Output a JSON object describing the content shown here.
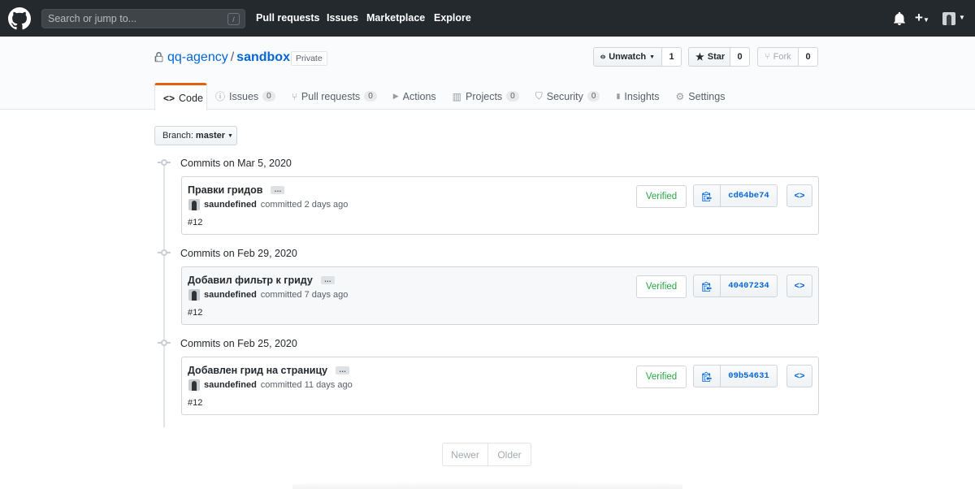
{
  "topnav": {
    "search_placeholder": "Search or jump to...",
    "search_hint": "/",
    "links": [
      "Pull requests",
      "Issues",
      "Marketplace",
      "Explore"
    ],
    "plus_label": "+"
  },
  "repo": {
    "owner": "qq-agency",
    "separator": "/",
    "name": "sandbox",
    "visibility": "Private",
    "watch_label": "Unwatch",
    "watch_count": "1",
    "star_label": "Star",
    "star_count": "0",
    "fork_label": "Fork",
    "fork_count": "0"
  },
  "tabs": [
    {
      "label": "Code",
      "icon": "code-icon",
      "glyph": "<>",
      "selected": true
    },
    {
      "label": "Issues",
      "icon": "issue-icon",
      "glyph": "ⓘ",
      "count": "0"
    },
    {
      "label": "Pull requests",
      "icon": "pull-request-icon",
      "glyph": "⑂",
      "count": "0"
    },
    {
      "label": "Actions",
      "icon": "play-icon",
      "glyph": "▶"
    },
    {
      "label": "Projects",
      "icon": "project-icon",
      "glyph": "▥",
      "count": "0"
    },
    {
      "label": "Security",
      "icon": "shield-icon",
      "glyph": "⛉",
      "count": "0"
    },
    {
      "label": "Insights",
      "icon": "graph-icon",
      "glyph": "▮"
    },
    {
      "label": "Settings",
      "icon": "gear-icon",
      "glyph": "⚙"
    }
  ],
  "branch": {
    "prefix": "Branch:",
    "name": "master"
  },
  "commit_groups": [
    {
      "title": "Commits on Mar 5, 2020",
      "message": "Правки гридов",
      "author": "saundefined",
      "action": "committed 2 days ago",
      "ref": "#12",
      "verified": "Verified",
      "sha": "cd64be74"
    },
    {
      "title": "Commits on Feb 29, 2020",
      "message": "Добавил фильтр к гриду",
      "author": "saundefined",
      "action": "committed 7 days ago",
      "ref": "#12",
      "verified": "Verified",
      "sha": "40407234"
    },
    {
      "title": "Commits on Feb 25, 2020",
      "message": "Добавлен грид на страницу",
      "author": "saundefined",
      "action": "committed 11 days ago",
      "ref": "#12",
      "verified": "Verified",
      "sha": "09b54631"
    }
  ],
  "ellipsis_label": "…",
  "browse_label": "<>",
  "pagination": {
    "newer": "Newer",
    "older": "Older"
  },
  "colors": {
    "header_bg": "#24292e",
    "link": "#0366d6",
    "verified": "#28a745",
    "tab_accent": "#e36209"
  }
}
